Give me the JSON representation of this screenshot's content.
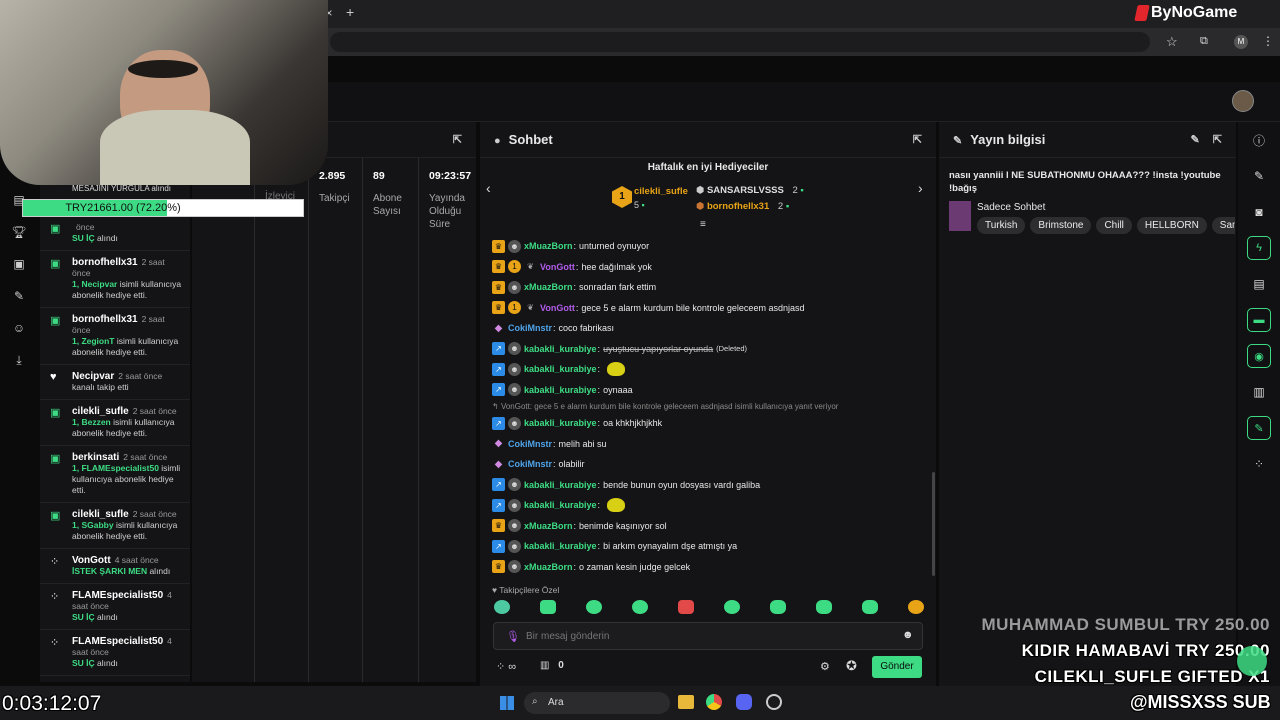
{
  "browser": {
    "new_tab_icon": "+",
    "close_tab_icon": "×",
    "brand": "ByNoGame",
    "profile_initial": "M"
  },
  "overlay": {
    "donation_label": "MESAJINI YURGULA alındı",
    "goal_text": "TRY21661.00 (72.20%)",
    "goal_progress": 0.722,
    "timer": "0:03:12:07",
    "donations": [
      {
        "text": "MUHAMMAD SUMBUL  TRY 250.00"
      },
      {
        "text": "KIDIR HAMABAVİ  TRY 250.00"
      },
      {
        "text": "CILEKLI_SUFLE  GIFTED X1"
      }
    ],
    "footer_tag": "@MISSXSS  SUB"
  },
  "activity": {
    "items": [
      {
        "icon": "gift-icon",
        "name": "",
        "time": "önce",
        "text_pre": "",
        "hl": "SU İÇ",
        "text_post": " alındı"
      },
      {
        "icon": "gift-icon",
        "name": "bornofhellx31",
        "time": "2 saat önce",
        "text_pre": "",
        "hl": "1, Necipvar",
        "text_post": " isimli kullanıcıya abonelik hediye etti."
      },
      {
        "icon": "gift-icon",
        "name": "bornofhellx31",
        "time": "2 saat önce",
        "text_pre": "",
        "hl": "1, ZegionT",
        "text_post": " isimli kullanıcıya abonelik hediye etti."
      },
      {
        "icon": "heart-icon",
        "name": "Necipvar",
        "time": "2 saat önce",
        "text_pre": "kanalı takip etti",
        "hl": "",
        "text_post": ""
      },
      {
        "icon": "gift-icon",
        "name": "cilekli_sufle",
        "time": "2 saat önce",
        "text_pre": "",
        "hl": "1, Bezzen",
        "text_post": " isimli kullanıcıya abonelik hediye etti."
      },
      {
        "icon": "gift-icon",
        "name": "berkinsati",
        "time": "2 saat önce",
        "text_pre": "",
        "hl": "1, FLAMEspecialist50",
        "text_post": " isimli kullanıcıya abonelik hediye etti."
      },
      {
        "icon": "gift-icon",
        "name": "cilekli_sufle",
        "time": "2 saat önce",
        "text_pre": "",
        "hl": "1, SGabby",
        "text_post": " isimli kullanıcıya abonelik hediye etti."
      },
      {
        "icon": "points-icon",
        "name": "VonGott",
        "time": "4 saat önce",
        "text_pre": "",
        "hl": "İSTEK ŞARKI MEN",
        "text_post": " alındı"
      },
      {
        "icon": "points-icon",
        "name": "FLAMEspecialist50",
        "time": "4 saat önce",
        "text_pre": "",
        "hl": "SU İÇ",
        "text_post": " alındı"
      },
      {
        "icon": "points-icon",
        "name": "FLAMEspecialist50",
        "time": "4 saat önce",
        "text_pre": "",
        "hl": "SU İÇ",
        "text_post": " alındı"
      }
    ]
  },
  "stats": {
    "title_fragment": "ri",
    "viewers_label": "İzleyici Sayısı",
    "followers_value": "2.895",
    "followers_label": "Takipçi",
    "subs_value": "89",
    "subs_label": "Abone Sayısı",
    "uptime_value": "09:23:57",
    "uptime_label": "Yayında Olduğu Süre"
  },
  "chat": {
    "title": "Sohbet",
    "gifters_title": "Haftalık en iyi Hediyeciler",
    "gifters": [
      {
        "rank": "1",
        "name": "cilekli_sufle",
        "count": "5"
      },
      {
        "rank": "",
        "name": "SANSARSLVSSS",
        "count": "2"
      },
      {
        "rank": "",
        "name": "bornofhellx31",
        "count": "2"
      }
    ],
    "messages": [
      {
        "badges": [
          "crown",
          "av"
        ],
        "user": "xMuazBorn",
        "color": "#3ddc84",
        "text": "unturned oynuyor"
      },
      {
        "badges": [
          "crown",
          "num",
          "fire"
        ],
        "user": "VonGott",
        "color": "#b05ce8",
        "text": "hee dağılmak yok"
      },
      {
        "badges": [
          "crown",
          "av"
        ],
        "user": "xMuazBorn",
        "color": "#3ddc84",
        "text": "sonradan fark ettim"
      },
      {
        "badges": [
          "crown",
          "num",
          "fire"
        ],
        "user": "VonGott",
        "color": "#b05ce8",
        "text": "gece 5 e alarm kurdum bile kontrole geleceem asdnjasd"
      },
      {
        "badges": [
          "dia"
        ],
        "user": "CokiMnstr",
        "color": "#4fa3e8",
        "text": "coco fabrikası"
      },
      {
        "badges": [
          "arrow",
          "av"
        ],
        "user": "kabakli_kurabiye",
        "color": "#3ddc84",
        "text": "uyuştucu yapıyorlar oyunda",
        "deleted": "(Deleted)"
      },
      {
        "badges": [
          "arrow",
          "av"
        ],
        "user": "kabakli_kurabiye",
        "color": "#3ddc84",
        "text": "",
        "emote": true
      },
      {
        "badges": [
          "arrow",
          "av"
        ],
        "user": "kabakli_kurabiye",
        "color": "#3ddc84",
        "text": "oynaaa"
      },
      {
        "reply": "VonGott: gece 5 e alarm kurdum bile kontrole geleceem asdnjasd isimli kullanıcıya yanıt veriyor"
      },
      {
        "badges": [
          "arrow",
          "av"
        ],
        "user": "kabakli_kurabiye",
        "color": "#3ddc84",
        "text": "oa khkhjkhjkhk"
      },
      {
        "badges": [
          "dia"
        ],
        "user": "CokiMnstr",
        "color": "#4fa3e8",
        "text": "melih abi su"
      },
      {
        "badges": [
          "dia"
        ],
        "user": "CokiMnstr",
        "color": "#4fa3e8",
        "text": "olabilir"
      },
      {
        "badges": [
          "arrow",
          "av"
        ],
        "user": "kabakli_kurabiye",
        "color": "#3ddc84",
        "text": "bende bunun oyun dosyası vardı galiba"
      },
      {
        "badges": [
          "arrow",
          "av"
        ],
        "user": "kabakli_kurabiye",
        "color": "#3ddc84",
        "text": "",
        "emote": true
      },
      {
        "badges": [
          "crown",
          "av"
        ],
        "user": "xMuazBorn",
        "color": "#3ddc84",
        "text": "benimde kaşınıyor sol"
      },
      {
        "badges": [
          "arrow",
          "av"
        ],
        "user": "kabakli_kurabiye",
        "color": "#3ddc84",
        "text": "bi arkım oynayalım dşe atmıştı ya"
      },
      {
        "badges": [
          "crown",
          "av"
        ],
        "user": "xMuazBorn",
        "color": "#3ddc84",
        "text": "o zaman kesin judge gelcek"
      }
    ],
    "followers_only_label": "Takipçilere Özel",
    "input_placeholder": "Bir mesaj gönderin",
    "infinity_label": "∞",
    "chest_count": "0",
    "send_label": "Gönder"
  },
  "info": {
    "title": "Yayın bilgisi",
    "stream_title": "nasıı yanniii l NE SUBATHONMU OHAAA??? !insta !youtube !bağış",
    "category": "Sadece Sohbet",
    "tags": [
      "Turkish",
      "Brimstone",
      "Chill",
      "HELLBORN",
      "Samimi"
    ]
  },
  "taskbar": {
    "search_label": "Ara"
  },
  "colors": {
    "accent": "#3ddc84",
    "gold": "#e8a317",
    "vip_purple": "#b05ce8"
  }
}
